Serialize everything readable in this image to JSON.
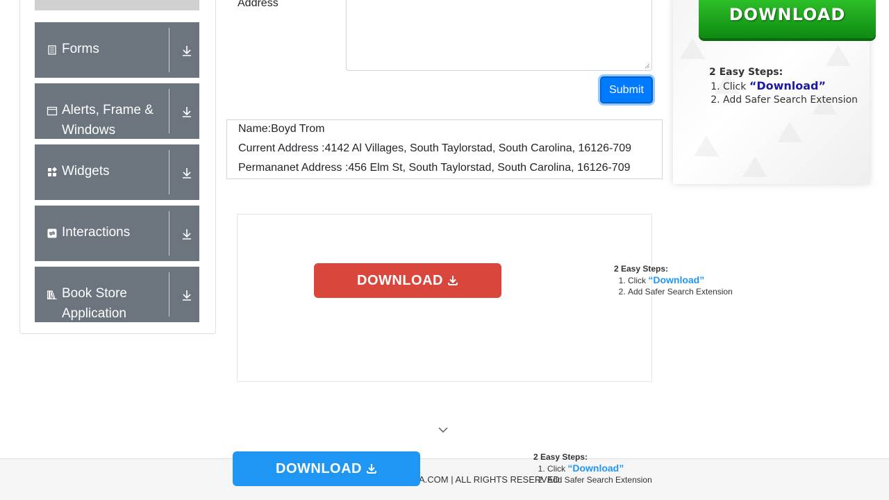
{
  "sidebar": {
    "items": [
      {
        "label": "Forms",
        "icon": "form-icon"
      },
      {
        "label": "Alerts, Frame & Windows",
        "icon": "window-icon"
      },
      {
        "label": "Widgets",
        "icon": "widgets-icon"
      },
      {
        "label": "Interactions",
        "icon": "interactions-icon"
      },
      {
        "label": "Book Store Application",
        "icon": "books-icon"
      }
    ]
  },
  "form": {
    "address_label": "Address",
    "submit_label": "Submit"
  },
  "output": {
    "name": "Name:Boyd Trom",
    "current_address": "Current Address :4142 Al Villages, South Taylorstad, South Carolina, 16126-709",
    "permanent_address": "Permananet Address :456 Elm St, South Taylorstad, South Carolina, 16126-709"
  },
  "ads": {
    "download_label": "DOWNLOAD",
    "steps_title": "2 Easy Steps:",
    "step1_prefix": "Click ",
    "step1_highlight": "“Download”",
    "step2": "Add Safer Search Extension"
  },
  "footer": {
    "text": "A.COM | ALL RIGHTS RESERVED."
  },
  "colors": {
    "sidebar_bg": "#6c757d",
    "submit_bg": "#007bff",
    "red_button": "#d9463b",
    "blue_button": "#1f96f3",
    "green_button": "#1ea81f"
  }
}
